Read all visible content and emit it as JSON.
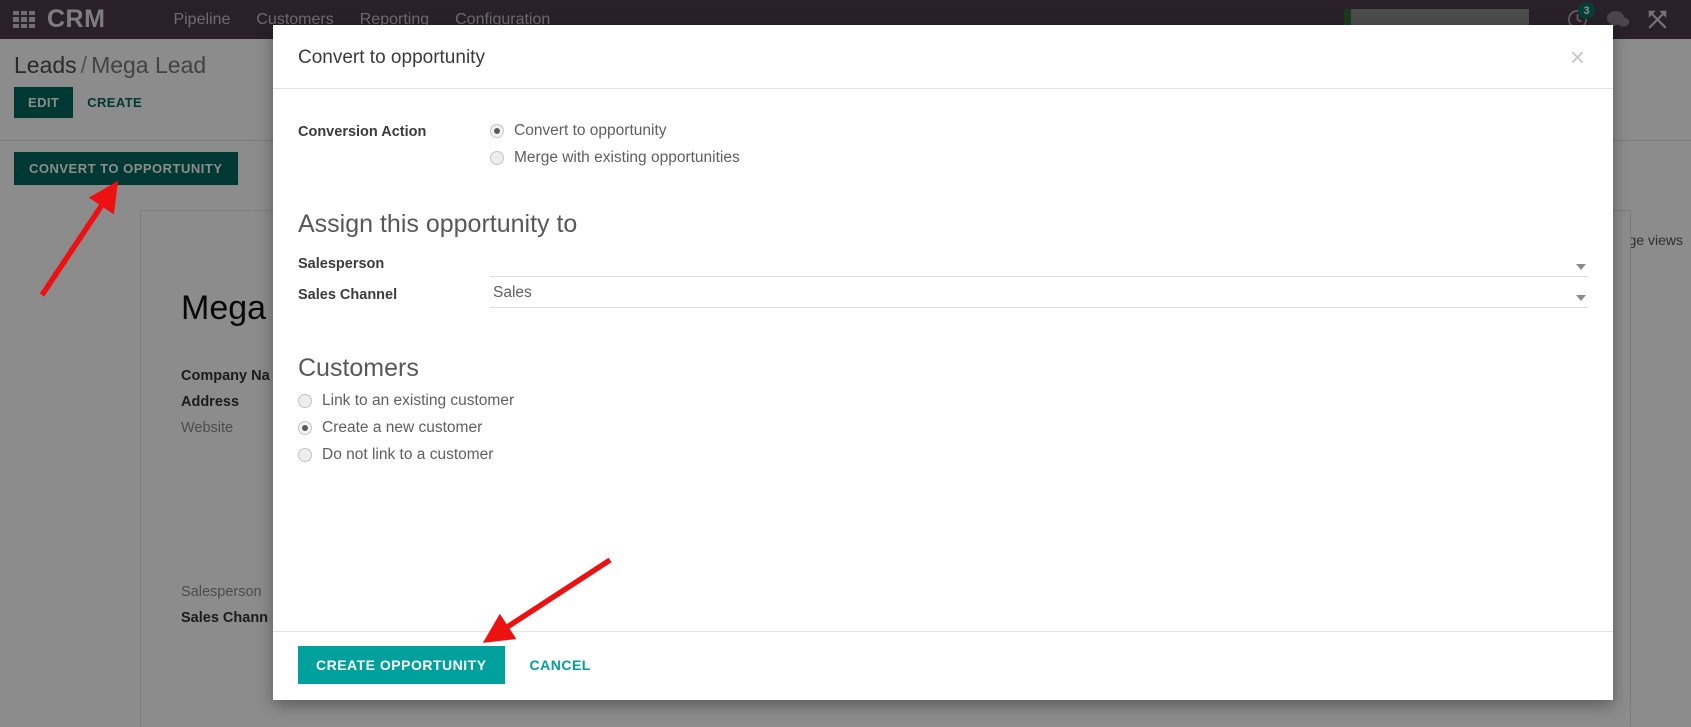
{
  "navbar": {
    "apps_icon": "apps-grid-icon",
    "brand": "CRM",
    "menu": [
      {
        "label": "Pipeline"
      },
      {
        "label": "Customers"
      },
      {
        "label": "Reporting"
      },
      {
        "label": "Configuration"
      }
    ],
    "activity_icon": "clock-activity-icon",
    "activity_badge": "3",
    "messages_icon": "chat-bubble-icon",
    "debug_icon": "wrench-tools-icon",
    "accent_color": "#4c3b4d"
  },
  "control_panel": {
    "breadcrumb_root": "Leads",
    "breadcrumb_sep": "/",
    "breadcrumb_current": "Mega Lead",
    "edit_label": "EDIT",
    "create_label": "CREATE",
    "convert_label": "CONVERT TO OPPORTUNITY",
    "manage_views": "age views"
  },
  "record": {
    "title": "Mega",
    "fields": [
      {
        "label": "Company Na",
        "muted": false
      },
      {
        "label": "Address",
        "muted": false
      },
      {
        "label": "Website",
        "muted": true
      }
    ],
    "fields_2": [
      {
        "label": "Salesperson",
        "muted": true
      },
      {
        "label": "Sales Chann",
        "muted": false
      }
    ]
  },
  "modal": {
    "title": "Convert to opportunity",
    "close_icon": "close-icon",
    "conversion_action": {
      "label": "Conversion Action",
      "options": [
        {
          "label": "Convert to opportunity",
          "checked": true
        },
        {
          "label": "Merge with existing opportunities",
          "checked": false
        }
      ]
    },
    "assign_section": {
      "heading": "Assign this opportunity to",
      "salesperson": {
        "label": "Salesperson",
        "value": "",
        "placeholder": "",
        "caret_icon": "chevron-down-icon"
      },
      "sales_channel": {
        "label": "Sales Channel",
        "value": "Sales",
        "placeholder": "",
        "caret_icon": "chevron-down-icon"
      }
    },
    "customers_section": {
      "heading": "Customers",
      "options": [
        {
          "label": "Link to an existing customer",
          "checked": false
        },
        {
          "label": "Create a new customer",
          "checked": true
        },
        {
          "label": "Do not link to a customer",
          "checked": false
        }
      ]
    },
    "footer": {
      "confirm_label": "CREATE OPPORTUNITY",
      "cancel_label": "CANCEL",
      "confirm_color": "#00a09d"
    }
  },
  "annotations": {
    "arrow_color": "#ee1111",
    "arrow_convert_target": "convert-to-opportunity-button",
    "arrow_create_target": "create-opportunity-button"
  }
}
